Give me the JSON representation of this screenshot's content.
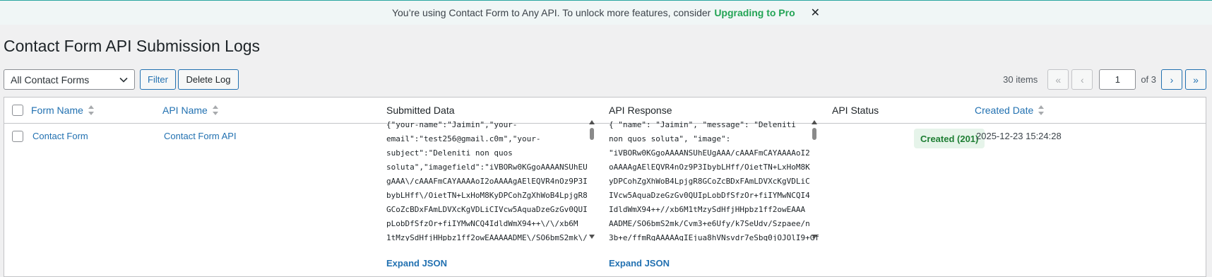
{
  "notice": {
    "text": "You’re using Contact Form to Any API. To unlock more features, consider",
    "cta": "Upgrading to Pro",
    "close_glyph": "✕"
  },
  "page": {
    "title": "Contact Form API Submission Logs"
  },
  "toolbar": {
    "form_select_value": "All Contact Forms",
    "filter_label": "Filter",
    "delete_label": "Delete Log"
  },
  "pagination": {
    "items_count": "30 items",
    "first_glyph": "«",
    "prev_glyph": "‹",
    "current_page": "1",
    "of_text": "of 3",
    "next_glyph": "›",
    "last_glyph": "»"
  },
  "table": {
    "headers": {
      "form_name": "Form Name",
      "api_name": "API Name",
      "submitted_data": "Submitted Data",
      "api_response": "API Response",
      "api_status": "API Status",
      "created_date": "Created Date"
    },
    "rows": [
      {
        "form_name": "Contact Form",
        "api_name": "Contact Form API",
        "submitted_data": "{\"your-name\":\"Jaimin\",\"your-\nemail\":\"test256@gmail.c0m\",\"your-\nsubject\":\"Deleniti non quos\nsoluta\",\"imagefield\":\"iVBORw0KGgoAAAANSUhEU\ngAAA\\/cAAAFmCAYAAAAoI2oAAAAgAElEQVR4nOz9P3I\nbybLHff\\/OietTN+LxHoM8KyDPCohZgXhWoB4LpjgR8\nGCoZcBDxFAmLDVXcKgVDLiCIVcw5AquaDzeGzGv0QUI\npLobDfSfzOr+fiIYMwNCQ4IdldWmX94++\\/\\/xb6M\n1tMzySdHfjHHpbz1ff2owEAAAAADME\\/SO6bmS2mk\\/",
        "api_response": "{ \"name\": \"Jaimin\", \"message\": \"Deleniti\nnon quos soluta\", \"image\":\n\"iVBORw0KGgoAAAANSUhEUgAAA/cAAAFmCAYAAAAoI2\noAAAAgAElEQVR4nOz9P3IbybLHff/OietTN+LxHoM8K\nyDPCohZgXhWoB4LpjgR8GCoZcBDxFAmLDVXcKgVDLiC\nIVcw5AquaDzeGzGv0QUIpLobDfSfzOr+fiIYMwNCQI4\nIdldWmX94++//xb6M1tMzySdHfjHHpbz1ff2owEAAA\nAADME/SO6bmS2mk/Cvm3+e6Ufy/k7SeUdv/Szpaee/n\n3b+e/ffmRgAAAAAgIEjua8hVNsvdr7eSbq0jOJOlI9+Gf",
        "expand_label": "Expand JSON",
        "expand_label_2": "Expand JSON",
        "api_status": "Created (201)",
        "created_date": "2025-12-23 15:24:28"
      }
    ]
  },
  "colors": {
    "accent": "#2271b1",
    "success_text": "#1e7e34",
    "success_bg": "#e6f4ea",
    "notice_cta": "#23a455"
  }
}
